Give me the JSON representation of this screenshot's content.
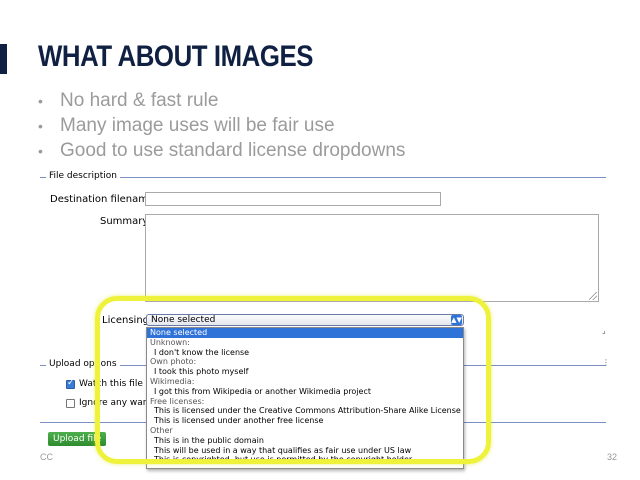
{
  "slide": {
    "title": "WHAT ABOUT IMAGES",
    "bullets": [
      "No hard & fast rule",
      "Many image uses will be fair use",
      "Good to use standard license dropdowns"
    ],
    "footer_left": "CC",
    "page_number": "32",
    "accent_color": "#0f2042",
    "highlight_color": "#eef23a"
  },
  "upload_form": {
    "file_description_legend": "File description",
    "destination_label": "Destination filename:",
    "destination_value": "",
    "summary_label": "Summary:",
    "summary_value": "",
    "licensing_label": "Licensing",
    "licensing_selected": "None selected",
    "licensing_options": [
      {
        "label": "None selected",
        "kind": "selected"
      },
      {
        "label": "Unknown:",
        "kind": "group"
      },
      {
        "label": "I don't know the license",
        "kind": "option"
      },
      {
        "label": "Own photo:",
        "kind": "group"
      },
      {
        "label": "I took this photo myself",
        "kind": "option"
      },
      {
        "label": "Wikimedia:",
        "kind": "group"
      },
      {
        "label": "I got this from Wikipedia or another Wikimedia project",
        "kind": "option"
      },
      {
        "label": "Free licenses:",
        "kind": "group"
      },
      {
        "label": "This is licensed under the Creative Commons Attribution-Share Alike License",
        "kind": "option"
      },
      {
        "label": "This is licensed under another free license",
        "kind": "option"
      },
      {
        "label": "Other",
        "kind": "group"
      },
      {
        "label": "This is in the public domain",
        "kind": "option"
      },
      {
        "label": "This will be used in a way that qualifies as fair use under US law",
        "kind": "option"
      },
      {
        "label": "This is copyrighted, but use is permitted by the copyright holder",
        "kind": "option"
      }
    ],
    "upload_options_legend": "Upload options",
    "watch_label": "Watch this file",
    "watch_checked": true,
    "ignore_label": "Ignore any warnings",
    "ignore_checked": false,
    "upload_button": "Upload file"
  }
}
